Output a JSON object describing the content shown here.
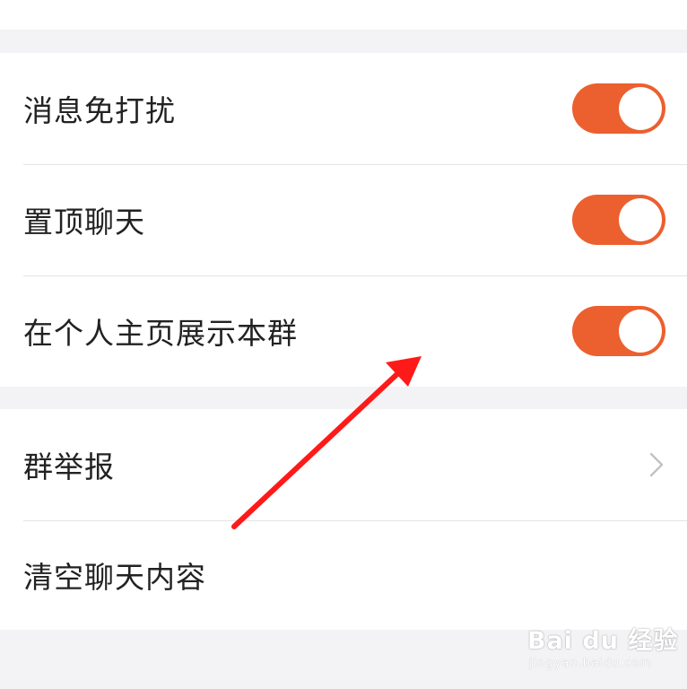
{
  "settings_group": {
    "items": [
      {
        "label": "消息免打扰",
        "toggle_on": true
      },
      {
        "label": "置顶聊天",
        "toggle_on": true
      },
      {
        "label": "在个人主页展示本群",
        "toggle_on": true
      }
    ]
  },
  "actions_group": {
    "items": [
      {
        "label": "群举报",
        "icon": "chevron-right-icon"
      },
      {
        "label": "清空聊天内容"
      }
    ]
  },
  "watermark": {
    "main": "Bai du 经验",
    "sub": "jingyan.baidu.com"
  },
  "colors": {
    "accent": "#ec5f2e",
    "annotation_arrow": "#ff1a1a",
    "background": "#f3f3f5",
    "row_background": "#ffffff",
    "divider": "#e4e4e6"
  }
}
